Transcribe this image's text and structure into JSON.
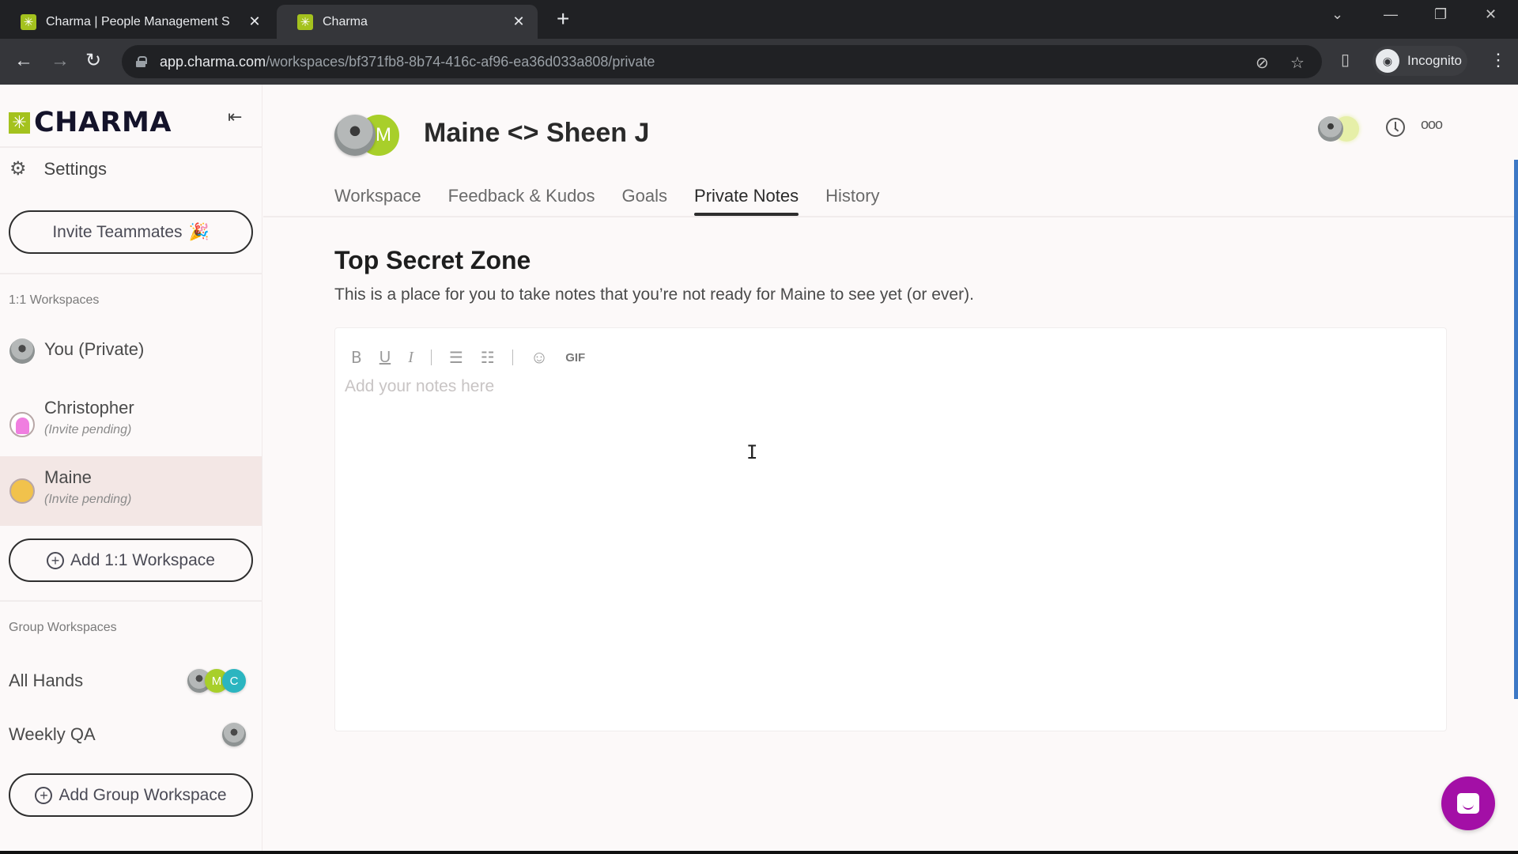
{
  "browser": {
    "tabs": [
      {
        "title": "Charma | People Management S",
        "active": false
      },
      {
        "title": "Charma",
        "active": true
      }
    ],
    "url_host": "app.charma.com",
    "url_path": "/workspaces/bf371fb8-8b74-416c-af96-ea36d033a808/private",
    "profile_label": "Incognito",
    "icons": {
      "favicon": "✳",
      "close": "✕",
      "new_tab": "+",
      "back": "←",
      "forward": "→",
      "reload": "↻",
      "eye_off": "⊘",
      "star": "☆",
      "sidepanel": "▯",
      "menu": "⋮",
      "tab_search": "⌄",
      "minimize": "—",
      "restore": "❐",
      "window_close": "✕",
      "incognito": "◉"
    }
  },
  "sidebar": {
    "logo_text": "CHARMA",
    "logo_mark": "✳",
    "collapse_icon": "⇤",
    "settings_icon": "⚙",
    "settings_label": "Settings",
    "invite_label": "Invite Teammates",
    "invite_emoji": "🎉",
    "one_on_one_heading": "1:1 Workspaces",
    "one_on_one": [
      {
        "name": "You (Private)",
        "sub": ""
      },
      {
        "name": "Christopher",
        "sub": "(Invite pending)"
      },
      {
        "name": "Maine",
        "sub": "(Invite pending)",
        "selected": true
      }
    ],
    "add_one_on_one_label": "Add 1:1 Workspace",
    "group_heading": "Group Workspaces",
    "groups": [
      {
        "name": "All Hands",
        "avatars": [
          "",
          "M",
          "C"
        ]
      },
      {
        "name": "Weekly QA",
        "avatars": [
          ""
        ]
      }
    ],
    "add_group_label": "Add Group Workspace",
    "plus_icon": "+"
  },
  "main": {
    "header_avatar_letter": "M",
    "title": "Maine <> Sheen J",
    "tabs": [
      {
        "label": "Workspace"
      },
      {
        "label": "Feedback & Kudos"
      },
      {
        "label": "Goals"
      },
      {
        "label": "Private Notes",
        "active": true
      },
      {
        "label": "History"
      }
    ],
    "more_icon": "ooo",
    "zone_title": "Top Secret Zone",
    "zone_desc": "This is a place for you to take notes that you’re not ready for Maine to see yet (or ever).",
    "toolbar": {
      "bold": "B",
      "underline": "U",
      "italic": "I",
      "bullet_list": "☰",
      "numbered_list": "☷",
      "emoji": "☺",
      "gif": "GIF"
    },
    "notes_value": "",
    "notes_placeholder": "Add your notes here",
    "text_cursor": "I"
  },
  "colors": {
    "brand_green": "#a4c21e",
    "avatar_green": "#a8cf2a",
    "avatar_teal": "#2bb5c0",
    "chat_purple": "#a30fa6",
    "selected_row": "#f3e7e5",
    "scrollbar_blue": "#3d78c5"
  }
}
